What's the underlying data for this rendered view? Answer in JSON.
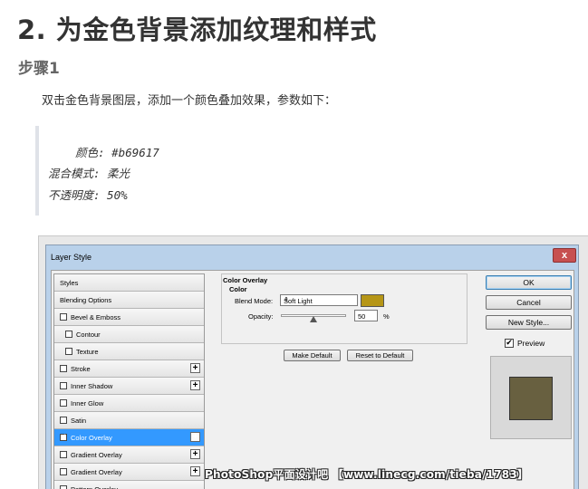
{
  "article": {
    "heading": "2. 为金色背景添加纹理和样式",
    "step": "步骤1",
    "paragraph": "双击金色背景图层，添加一个颜色叠加效果，参数如下：",
    "params": [
      "    颜色: #b69617",
      "混合模式: 柔光",
      "不透明度: 50%"
    ]
  },
  "dialog": {
    "title": "Layer Style",
    "close_glyph": "x",
    "styles_list": [
      {
        "label": "Styles",
        "checkbox": false,
        "checked": false,
        "plus": false,
        "selected": false
      },
      {
        "label": "Blending Options",
        "checkbox": false,
        "checked": false,
        "plus": false,
        "selected": false
      },
      {
        "label": "Bevel & Emboss",
        "checkbox": true,
        "checked": false,
        "plus": false,
        "selected": false
      },
      {
        "label": "Contour",
        "checkbox": true,
        "checked": false,
        "plus": false,
        "selected": false,
        "indent": true
      },
      {
        "label": "Texture",
        "checkbox": true,
        "checked": false,
        "plus": false,
        "selected": false,
        "indent": true
      },
      {
        "label": "Stroke",
        "checkbox": true,
        "checked": false,
        "plus": true,
        "selected": false
      },
      {
        "label": "Inner Shadow",
        "checkbox": true,
        "checked": false,
        "plus": true,
        "selected": false
      },
      {
        "label": "Inner Glow",
        "checkbox": true,
        "checked": false,
        "plus": false,
        "selected": false
      },
      {
        "label": "Satin",
        "checkbox": true,
        "checked": false,
        "plus": false,
        "selected": false
      },
      {
        "label": "Color Overlay",
        "checkbox": true,
        "checked": true,
        "plus": true,
        "selected": true
      },
      {
        "label": "Gradient Overlay",
        "checkbox": true,
        "checked": false,
        "plus": true,
        "selected": false
      },
      {
        "label": "Gradient Overlay",
        "checkbox": true,
        "checked": false,
        "plus": true,
        "selected": false
      },
      {
        "label": "Pattern Overlay",
        "checkbox": true,
        "checked": false,
        "plus": false,
        "selected": false
      }
    ],
    "panel": {
      "title": "Color Overlay",
      "subtitle": "Color",
      "blend_mode_label": "Blend Mode:",
      "blend_mode_value": "Soft Light",
      "overlay_color": "#b69617",
      "opacity_label": "Opacity:",
      "opacity_value": "50",
      "opacity_fraction": 0.5,
      "opacity_unit": "%",
      "make_default": "Make Default",
      "reset_default": "Reset to Default"
    },
    "buttons": {
      "ok": "OK",
      "cancel": "Cancel",
      "new_style": "New Style...",
      "preview_label": "Preview",
      "preview_checked": true
    },
    "preview_color": "#686040"
  },
  "watermark": "PhotoShop平面设计吧 【www.linecg.com/tieba/1783】",
  "colors": {
    "selection": "#3399ff",
    "titlebar": "#b9d1ea"
  }
}
